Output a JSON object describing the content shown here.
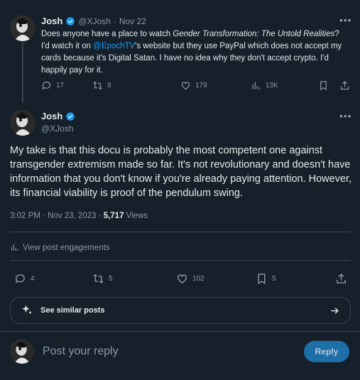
{
  "parent": {
    "name": "Josh",
    "handle": "@XJosh",
    "time": "Nov 22",
    "text_1": "Does anyone have a place to watch ",
    "text_italic": "Gender Transformation: The Untold Realities",
    "text_2": "? I'd watch it on ",
    "mention": "@EpochTV",
    "text_3": "'s website but they use PayPal which does not accept my cards because it's Digital Satan. I have no idea why they don't accept crypto. I'd happily pay for it.",
    "replies": "17",
    "reposts": "9",
    "likes": "179",
    "views": "13K"
  },
  "main": {
    "name": "Josh",
    "handle": "@XJosh",
    "text": "My take is that this docu is probably the most competent one against transgender extremism made so far. It's not revolutionary and doesn't have information that you don't know if you're already paying attention. However, its financial viability is proof of the pendulum swing.",
    "timestamp": "3:02 PM · Nov 23, 2023 · ",
    "views_count": "5,717",
    "views_label": " Views",
    "engagements_label": "View post engagements",
    "replies": "4",
    "reposts": "5",
    "likes": "102",
    "bookmarks": "5"
  },
  "similar": {
    "label": "See similar posts"
  },
  "compose": {
    "placeholder": "Post your reply",
    "button": "Reply"
  },
  "colors": {
    "background": "#15202b",
    "accent": "#1d9bf0",
    "muted": "#8b98a5"
  }
}
